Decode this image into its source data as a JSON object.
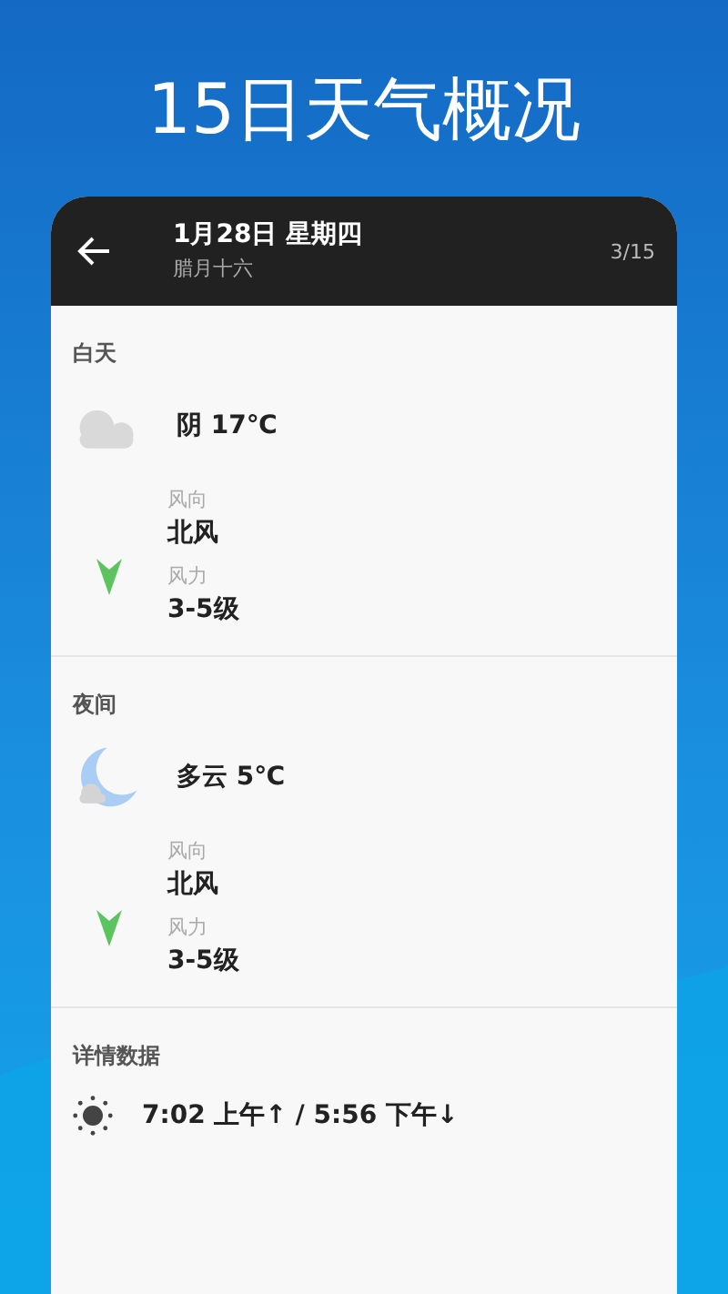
{
  "page_title": "15日天气概况",
  "header": {
    "date": "1月28日 星期四",
    "lunar": "腊月十六",
    "counter": "3/15"
  },
  "periods": [
    {
      "label": "白天",
      "kind": "cloudy",
      "condition": "阴 17℃",
      "wind_direction_label": "风向",
      "wind_direction": "北风",
      "wind_force_label": "风力",
      "wind_force": "3-5级"
    },
    {
      "label": "夜间",
      "kind": "moon-cloud",
      "condition": "多云 5℃",
      "wind_direction_label": "风向",
      "wind_direction": "北风",
      "wind_force_label": "风力",
      "wind_force": "3-5级"
    }
  ],
  "details": {
    "label": "详情数据",
    "sun_times": "7:02 上午↑ / 5:56 下午↓"
  }
}
